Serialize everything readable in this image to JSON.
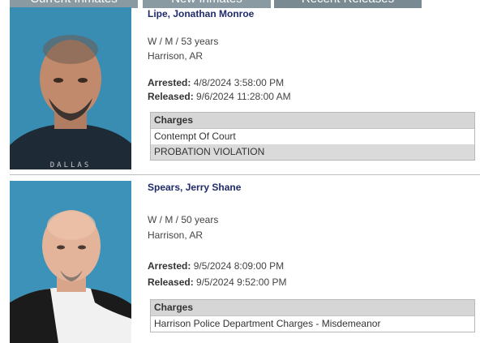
{
  "tabs": [
    {
      "label": "Current Inmates"
    },
    {
      "label": "New Inmates"
    },
    {
      "label": "Recent Releases"
    }
  ],
  "releases": [
    {
      "name": "Lipe, Jonathan Monroe",
      "demographics": "W / M / 53 years",
      "location": "Harrison, AR",
      "arrested_label": "Arrested:",
      "arrested": "4/8/2024 3:58:00 PM",
      "released_label": "Released:",
      "released": "9/6/2024 11:28:00 AM",
      "charges_header": "Charges",
      "charges": [
        "Contempt Of Court",
        "PROBATION VIOLATION"
      ],
      "shirt_text": "DALLAS"
    },
    {
      "name": "Spears, Jerry Shane",
      "demographics": "W / M / 50 years",
      "location": "Harrison, AR",
      "arrested_label": "Arrested:",
      "arrested": "9/5/2024 8:09:00 PM",
      "released_label": "Released:",
      "released": "9/5/2024 9:52:00 PM",
      "charges_header": "Charges",
      "charges": [
        "Harrison Police Department Charges - Misdemeanor"
      ]
    }
  ],
  "colors": {
    "name_link": "#1f2b6a",
    "charges_header_bg": "#d6d6d6",
    "tab_bg": "#8a9aa2",
    "photo_backdrop": "#3a8fb5"
  }
}
